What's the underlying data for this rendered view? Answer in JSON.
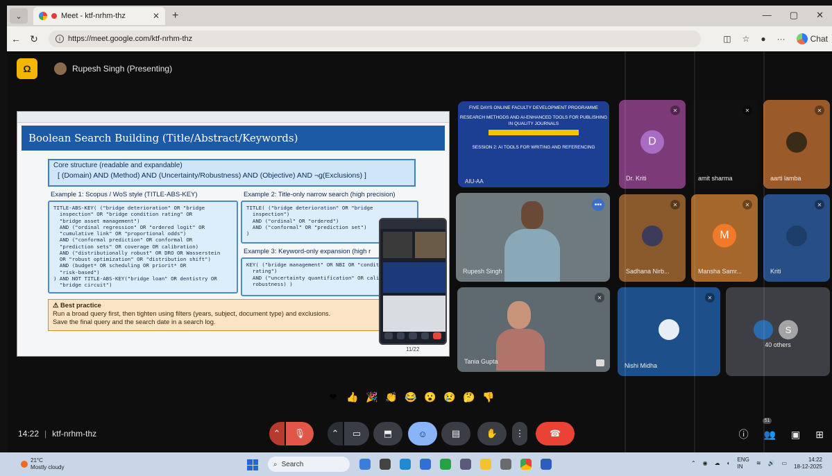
{
  "browser": {
    "tab_title": "Meet - ktf-nrhm-thz",
    "url": "https://meet.google.com/ktf-nrhm-thz",
    "copilot_label": "Chat"
  },
  "meet": {
    "presenter": "Rupesh Singh (Presenting)",
    "meeting_time": "14:22",
    "meeting_code": "ktf-nrhm-thz",
    "people_count": "51"
  },
  "slide": {
    "title": "Boolean Search Building (Title/Abstract/Keywords)",
    "core_title": "Core structure (readable and expandable)",
    "core_line": "[ (Domain) AND (Method) AND (Uncertainty/Robustness) AND (Objective) AND ¬g(Exclusions) ]",
    "ex1_title": "Example 1: Scopus / WoS style (TITLE-ABS-KEY)",
    "ex1_body": "TITLE-ABS-KEY( (\"bridge deterioration\" OR \"bridge\n  inspection\" OR \"bridge condition rating\" OR\n  \"bridge asset management\")\n  AND (\"ordinal regression\" OR \"ordered logit\" OR\n  \"cumulative link\" OR \"proportional odds\")\n  AND (\"conformal prediction\" OR conformal OR\n  \"prediction sets\" OR coverage OR calibration)\n  AND (\"distributionally robust\" OR DRO OR Wasserstein\n  OR \"robust optimization\" OR \"distribution shift\")\n  AND (budget* OR scheduling OR priorit* OR\n  \"risk-based\")\n) AND NOT TITLE-ABS-KEY(\"bridge loan\" OR dentistry OR\n  \"bridge circuit\")",
    "ex2_title": "Example 2: Title-only narrow search (high precision)",
    "ex2_body": "TITLE( (\"bridge deterioration\" OR \"bridge\n  inspection\")\n  AND (\"ordinal\" OR \"ordered\")\n  AND (\"conformal\" OR \"prediction set\")\n)",
    "ex3_title": "Example 3: Keyword-only expansion (high r",
    "ex3_body": "KEY( (\"bridge management\" OR NBI OR \"conditi\n  rating\")\n  AND (\"uncertainty quantification\" OR calib\n  robustness) )",
    "best_title": "Best practice",
    "best_line1": "Run a broad query first, then tighten using filters (years, subject, document type) and exclusions.",
    "best_line2": "Save the final query and the search date in a search log.",
    "page": "11/22"
  },
  "tiles": {
    "present_title": "FIVE DAYS ONLINE FACULTY DEVELOPMENT PROGRAMME",
    "present_sub": "RESEARCH METHODS AND AI-ENHANCED TOOLS FOR PUBLISHING IN QUALITY JOURNALS",
    "present_session": "SESSION 2: AI TOOLS FOR WRITING AND REFERENCING",
    "present_label": "AIU-AA",
    "kriti": "Dr. Kriti",
    "kriti_initial": "D",
    "amit": "amit sharma",
    "aarti": "aarti lamba",
    "rupesh": "Rupesh Singh",
    "sadhana": "Sadhana Nirb...",
    "mansha": "Mansha Samr...",
    "mansha_initial": "M",
    "kriti2": "Kriti",
    "tania": "Tania Gupta",
    "nishi": "Nishi Midha",
    "others": "40 others",
    "others_initial": "S"
  },
  "reactions": [
    "❤",
    "👍",
    "🎉",
    "👏",
    "😂",
    "😮",
    "😢",
    "🤔",
    "👎"
  ],
  "taskbar": {
    "temp": "21°C",
    "weather": "Mostly cloudy",
    "search": "Search",
    "lang1": "ENG",
    "lang2": "IN",
    "time": "14:22",
    "date": "18-12-2025"
  }
}
